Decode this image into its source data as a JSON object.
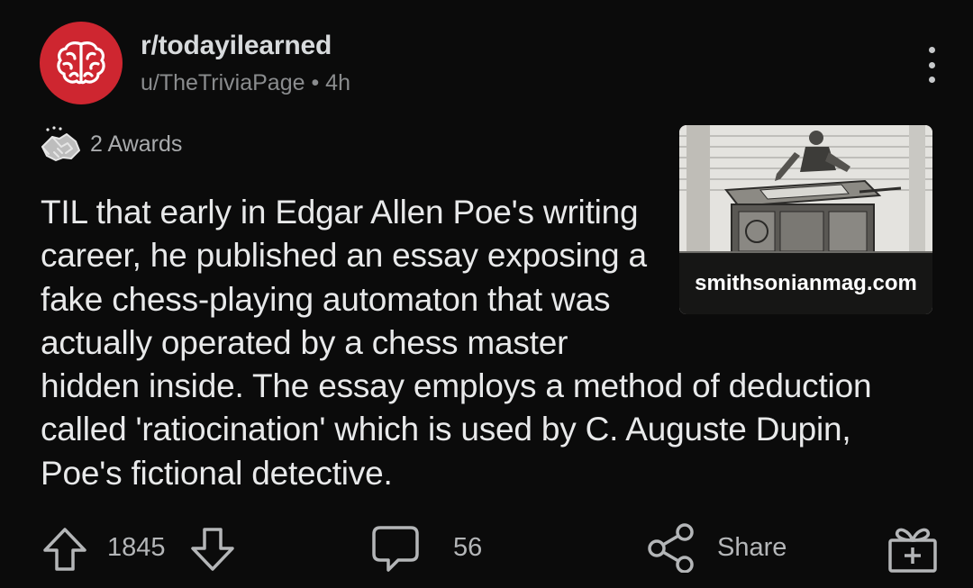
{
  "post": {
    "subreddit": "r/todayilearned",
    "author": "u/TheTriviaPage",
    "separator": "•",
    "age": "4h",
    "awards_label": "2 Awards",
    "title": "TIL that early in Edgar Allen Poe's writing career, he published an essay exposing a fake chess-playing automaton that was actually operated by a chess master hidden inside. The essay employs a method of deduction called 'ratiocination' which is used by C. Auguste Dupin, Poe's fictional detective.",
    "link_domain": "smithsonianmag.com"
  },
  "actions": {
    "upvotes": "1845",
    "comments": "56",
    "share_label": "Share"
  },
  "icons": {
    "avatar": "brain-icon",
    "more": "more-vertical-icon",
    "awards": "handshake-icon",
    "upvote": "arrow-up-icon",
    "downvote": "arrow-down-icon",
    "comment": "comment-bubble-icon",
    "share": "share-icon",
    "award": "gift-icon"
  },
  "colors": {
    "background": "#0b0b0b",
    "subreddit_avatar": "#ce2630",
    "text_primary": "#e8e9ea",
    "text_secondary": "#8a8c8e"
  }
}
